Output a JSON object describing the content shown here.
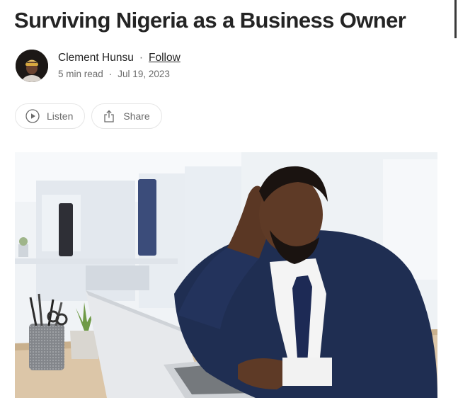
{
  "article": {
    "title": "Surviving Nigeria as a Business Owner"
  },
  "author": {
    "name": "Clement Hunsu",
    "follow_label": "Follow",
    "separator": "·",
    "read_time": "5 min read",
    "date": "Jul 19, 2023"
  },
  "actions": {
    "listen_label": "Listen",
    "share_label": "Share"
  },
  "icons": {
    "listen": "play-circle-icon",
    "share": "share-icon"
  },
  "colors": {
    "text": "#242424",
    "muted": "#6b6b6b",
    "pill_border": "#e6e6e6"
  }
}
